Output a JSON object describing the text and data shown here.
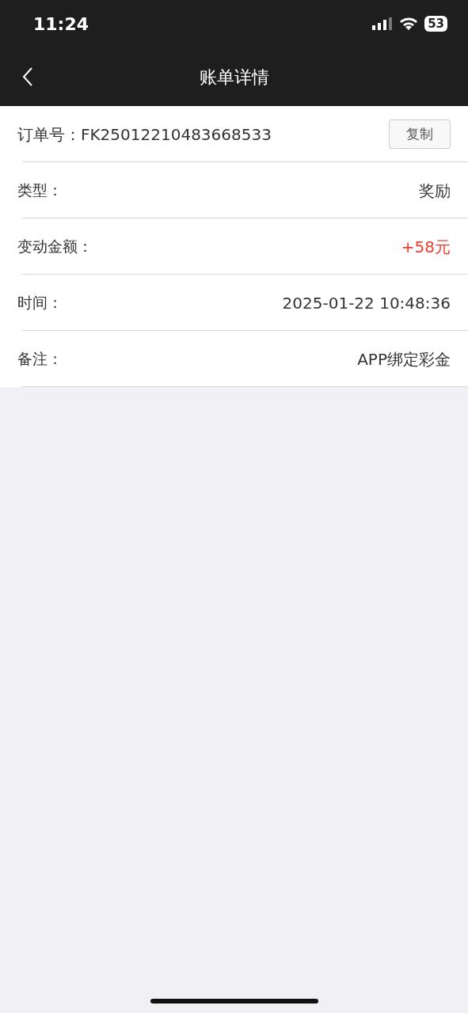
{
  "status_bar": {
    "time": "11:24",
    "battery": "53"
  },
  "header": {
    "title": "账单详情"
  },
  "order": {
    "text": "订单号：FK25012210483668533",
    "button": "复制"
  },
  "rows": [
    {
      "label": "类型：",
      "value": "奖励",
      "kind": "plain"
    },
    {
      "label": "变动金额：",
      "value": "+58元",
      "kind": "amount"
    },
    {
      "label": "时间：",
      "value": "2025-01-22 10:48:36",
      "kind": "plain"
    },
    {
      "label": "备注：",
      "value": "APP绑定彩金",
      "kind": "plain"
    }
  ]
}
